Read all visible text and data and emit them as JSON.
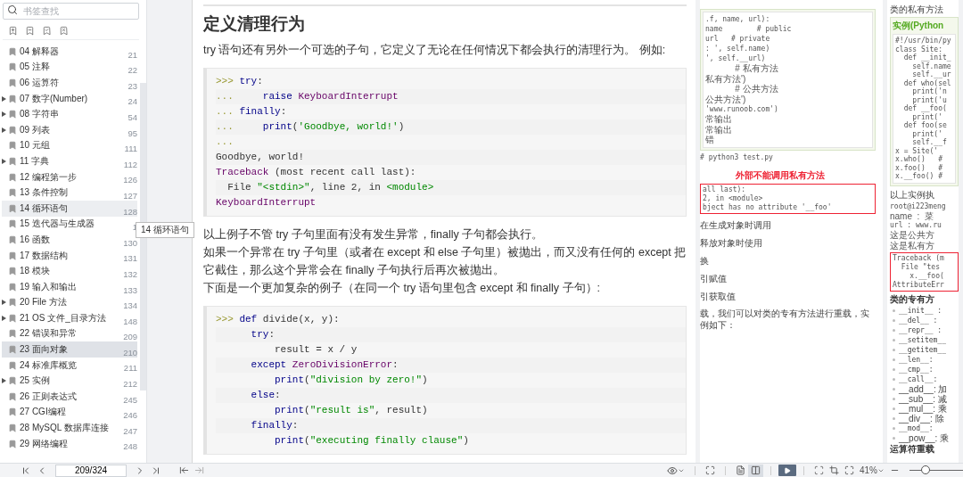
{
  "sidebar": {
    "search": {
      "placeholder": "书签查找"
    },
    "bookmarks": [
      {
        "label": "04 解释器",
        "page": "21",
        "expandable": false,
        "selected": false,
        "hovered": false
      },
      {
        "label": "05 注释",
        "page": "22",
        "expandable": false,
        "selected": false,
        "hovered": false
      },
      {
        "label": "06 运算符",
        "page": "23",
        "expandable": false,
        "selected": false,
        "hovered": false
      },
      {
        "label": "07 数字(Number)",
        "page": "24",
        "expandable": true,
        "selected": false,
        "hovered": false
      },
      {
        "label": "08 字符串",
        "page": "54",
        "expandable": true,
        "selected": false,
        "hovered": false
      },
      {
        "label": "09 列表",
        "page": "95",
        "expandable": true,
        "selected": false,
        "hovered": false
      },
      {
        "label": "10 元组",
        "page": "111",
        "expandable": false,
        "selected": false,
        "hovered": false
      },
      {
        "label": "11 字典",
        "page": "112",
        "expandable": true,
        "selected": false,
        "hovered": false
      },
      {
        "label": "12 编程第一步",
        "page": "126",
        "expandable": false,
        "selected": false,
        "hovered": false
      },
      {
        "label": "13 条件控制",
        "page": "127",
        "expandable": false,
        "selected": false,
        "hovered": false
      },
      {
        "label": "14 循环语句",
        "page": "128",
        "expandable": false,
        "selected": false,
        "hovered": true
      },
      {
        "label": "15 迭代器与生成器",
        "page": "1",
        "expandable": false,
        "selected": false,
        "hovered": false
      },
      {
        "label": "16 函数",
        "page": "130",
        "expandable": false,
        "selected": false,
        "hovered": false
      },
      {
        "label": "17 数据结构",
        "page": "131",
        "expandable": false,
        "selected": false,
        "hovered": false
      },
      {
        "label": "18 模块",
        "page": "132",
        "expandable": false,
        "selected": false,
        "hovered": false
      },
      {
        "label": "19 输入和输出",
        "page": "133",
        "expandable": false,
        "selected": false,
        "hovered": false
      },
      {
        "label": "20 File 方法",
        "page": "134",
        "expandable": true,
        "selected": false,
        "hovered": false
      },
      {
        "label": "21 OS 文件_目录方法",
        "page": "148",
        "expandable": true,
        "selected": false,
        "hovered": false
      },
      {
        "label": "22 错误和异常",
        "page": "209",
        "expandable": false,
        "selected": false,
        "hovered": false
      },
      {
        "label": "23 面向对象",
        "page": "210",
        "expandable": false,
        "selected": true,
        "hovered": false
      },
      {
        "label": "24 标准库概览",
        "page": "211",
        "expandable": false,
        "selected": false,
        "hovered": false
      },
      {
        "label": "25 实例",
        "page": "212",
        "expandable": true,
        "selected": false,
        "hovered": false
      },
      {
        "label": "26 正则表达式",
        "page": "245",
        "expandable": false,
        "selected": false,
        "hovered": false
      },
      {
        "label": "27 CGI编程",
        "page": "246",
        "expandable": false,
        "selected": false,
        "hovered": false
      },
      {
        "label": "28 MySQL 数据库连接",
        "page": "247",
        "expandable": false,
        "selected": false,
        "hovered": false
      },
      {
        "label": "29 网络编程",
        "page": "248",
        "expandable": false,
        "selected": false,
        "hovered": false
      }
    ],
    "tooltip": "14 循环语句"
  },
  "document": {
    "blocks": [
      {
        "kind": "heading",
        "text": "定义清理行为"
      },
      {
        "kind": "paragraph",
        "text": "try 语句还有另外一个可选的子句，它定义了无论在任何情况下都会执行的清理行为。 例如:"
      },
      {
        "kind": "code",
        "lines": [
          [
            {
              "kind": "prompt",
              "text": ">>> "
            },
            {
              "kind": "kw",
              "text": "try"
            },
            {
              "kind": "plain",
              "text": ":"
            }
          ],
          [
            {
              "kind": "prompt",
              "text": "...     "
            },
            {
              "kind": "kw",
              "text": "raise "
            },
            {
              "kind": "name",
              "text": "KeyboardInterrupt"
            }
          ],
          [
            {
              "kind": "prompt",
              "text": "... "
            },
            {
              "kind": "kw",
              "text": "finally"
            },
            {
              "kind": "plain",
              "text": ":"
            }
          ],
          [
            {
              "kind": "prompt",
              "text": "...     "
            },
            {
              "kind": "kw",
              "text": "print"
            },
            {
              "kind": "plain",
              "text": "("
            },
            {
              "kind": "str",
              "text": "'Goodbye, world!'"
            },
            {
              "kind": "plain",
              "text": ")"
            }
          ],
          [
            {
              "kind": "prompt",
              "text": "..."
            }
          ],
          [
            {
              "kind": "plain",
              "text": "Goodbye, world!"
            }
          ],
          [
            {
              "kind": "name",
              "text": "Traceback"
            },
            {
              "kind": "plain",
              "text": " (most recent call last):"
            }
          ],
          [
            {
              "kind": "plain",
              "text": "  File "
            },
            {
              "kind": "str",
              "text": "\"<stdin>\""
            },
            {
              "kind": "plain",
              "text": ", line 2, in "
            },
            {
              "kind": "str",
              "text": "<module>"
            }
          ],
          [
            {
              "kind": "name",
              "text": "KeyboardInterrupt"
            }
          ]
        ]
      },
      {
        "kind": "paragraph",
        "text": "以上例子不管 try 子句里面有没有发生异常，finally 子句都会执行。"
      },
      {
        "kind": "paragraph",
        "text": "如果一个异常在 try 子句里（或者在 except 和 else 子句里）被抛出，而又没有任何的 except 把它截住，那么这个异常会在 finally 子句执行后再次被抛出。"
      },
      {
        "kind": "paragraph",
        "text": "下面是一个更加复杂的例子（在同一个 try 语句里包含 except 和 finally 子句）:"
      },
      {
        "kind": "code",
        "lines": [
          [
            {
              "kind": "prompt",
              "text": ">>> "
            },
            {
              "kind": "kw",
              "text": "def"
            },
            {
              "kind": "plain",
              "text": " divide(x, y):"
            }
          ],
          [
            {
              "kind": "kw",
              "text": "      try"
            },
            {
              "kind": "plain",
              "text": ":"
            }
          ],
          [
            {
              "kind": "plain",
              "text": "          result = x / y"
            }
          ],
          [
            {
              "kind": "kw",
              "text": "      except "
            },
            {
              "kind": "name",
              "text": "ZeroDivisionError"
            },
            {
              "kind": "plain",
              "text": ":"
            }
          ],
          [
            {
              "kind": "kw",
              "text": "          print"
            },
            {
              "kind": "plain",
              "text": "("
            },
            {
              "kind": "str",
              "text": "\"division by zero!\""
            },
            {
              "kind": "plain",
              "text": ")"
            }
          ],
          [
            {
              "kind": "kw",
              "text": "      else"
            },
            {
              "kind": "plain",
              "text": ":"
            }
          ],
          [
            {
              "kind": "kw",
              "text": "          print"
            },
            {
              "kind": "plain",
              "text": "("
            },
            {
              "kind": "str",
              "text": "\"result is\""
            },
            {
              "kind": "plain",
              "text": ", result)"
            }
          ],
          [
            {
              "kind": "kw",
              "text": "      finally"
            },
            {
              "kind": "plain",
              "text": ":"
            }
          ],
          [
            {
              "kind": "kw",
              "text": "          print"
            },
            {
              "kind": "plain",
              "text": "("
            },
            {
              "kind": "str",
              "text": "\"executing finally clause\""
            },
            {
              "kind": "plain",
              "text": ")"
            }
          ]
        ]
      }
    ]
  },
  "thumbnails": [
    {
      "sections": [
        {
          "kind": "code",
          "lines": [
            ".f, name, url):",
            "name        # public",
            "url   # private",
            ": ', self.name)",
            "', self.__url)",
            "            # 私有方法",
            "私有方法')",
            "            # 公共方法",
            "公共方法')",
            "'www.runoob.com')",
            "常输出",
            "常输出",
            "错"
          ]
        },
        {
          "kind": "output",
          "lines": [
            "# python3 test.py"
          ]
        },
        {
          "kind": "note",
          "lines": [
            "外部不能调用私有方法"
          ]
        },
        {
          "kind": "error",
          "lines": [
            "all last):",
            "2, in <module>",
            "bject has no attribute '__foo'"
          ]
        },
        {
          "kind": "text",
          "lines": [
            "在生成对象时调用",
            "释放对象时使用",
            "换",
            "引赋值",
            "引获取值"
          ]
        },
        {
          "kind": "text",
          "lines": [
            "载，我们可以对类的专有方法进行重载，实例如下："
          ]
        }
      ]
    },
    {
      "sections": [
        {
          "kind": "text",
          "lines": [
            "类的私有方法"
          ]
        },
        {
          "kind": "example",
          "title": "实例(Python",
          "lines": [
            "#!/usr/bin/py",
            "class Site:",
            "  def __init_",
            "    self.name",
            "    self.__ur",
            "  def who(sel",
            "    print('n",
            "    print('u",
            "  def __foo(",
            "    print('",
            "  def foo(se",
            "    print('",
            "    self.__f",
            "x = Site('",
            "x.who()   #",
            "x.foo()   #",
            "x.__foo() #"
          ]
        },
        {
          "kind": "text",
          "lines": [
            "以上实例执"
          ]
        },
        {
          "kind": "output",
          "lines": [
            "root@i223meng",
            "name  :  菜",
            "url : www.ru",
            "这是公共方",
            "这是私有方"
          ]
        },
        {
          "kind": "error",
          "lines": [
            "Traceback (m",
            "  File \"tes",
            "    x.__foo(",
            "AttributeErr"
          ]
        },
        {
          "kind": "subtitle",
          "lines": [
            "类的专有方"
          ]
        },
        {
          "kind": "bullets",
          "lines": [
            "__init__ :",
            "__del__ :",
            "__repr__ :",
            "__setitem__",
            "__getitem__",
            "__len__:",
            "__cmp__:",
            "__call__:",
            "__add__: 加",
            "__sub__: 减",
            "__mul__: 乘",
            "__div__: 除",
            "__mod__:",
            "__pow__: 乘"
          ]
        },
        {
          "kind": "subtitle",
          "lines": [
            "运算符重载"
          ]
        }
      ]
    }
  ],
  "toolbar": {
    "page_field": "209/324",
    "double_page": true,
    "zoom": "41%",
    "zoom_slider": {
      "level": 0.3
    }
  }
}
